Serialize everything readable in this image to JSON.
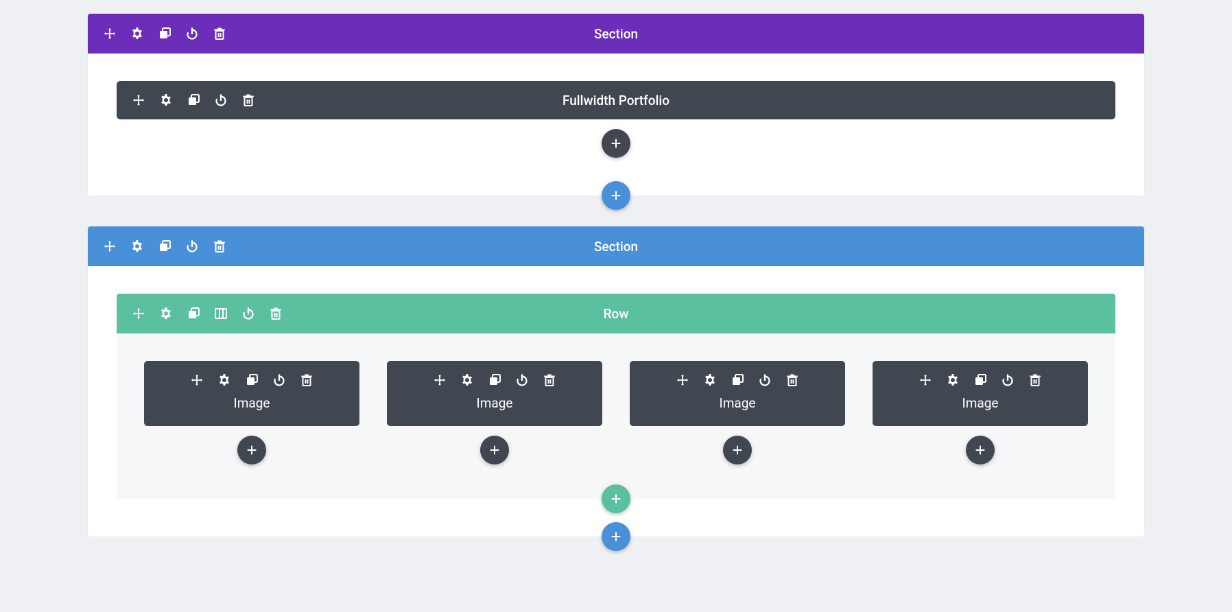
{
  "colors": {
    "purple": "#6c2eb9",
    "blue": "#4a90d9",
    "teal": "#5bc0a0",
    "dark": "#414750"
  },
  "section1": {
    "title": "Section",
    "module": {
      "title": "Fullwidth Portfolio"
    }
  },
  "section2": {
    "title": "Section",
    "row": {
      "title": "Row",
      "columns": [
        {
          "label": "Image"
        },
        {
          "label": "Image"
        },
        {
          "label": "Image"
        },
        {
          "label": "Image"
        }
      ]
    }
  },
  "icons": {
    "move": "move-icon",
    "settings": "gear-icon",
    "duplicate": "duplicate-icon",
    "columns": "columns-icon",
    "power": "power-icon",
    "delete": "trash-icon",
    "add": "plus-icon"
  }
}
